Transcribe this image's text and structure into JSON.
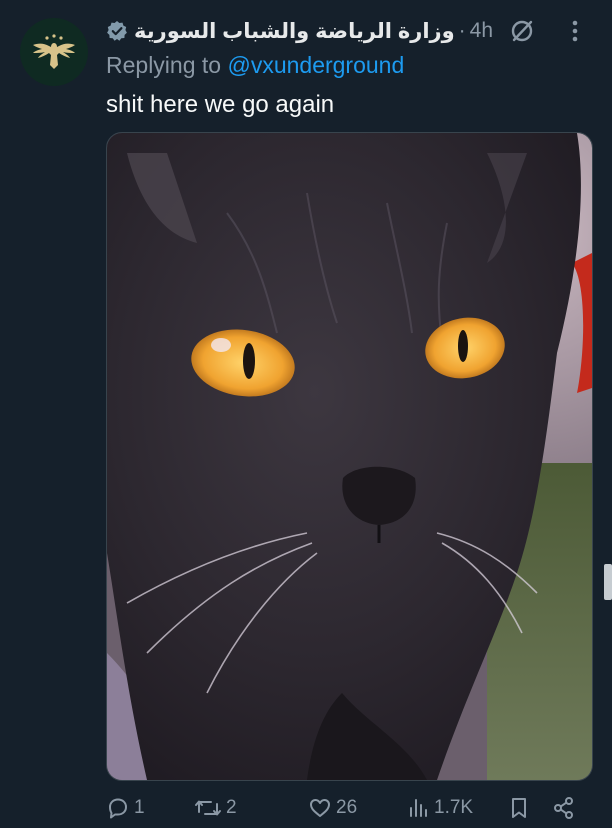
{
  "tweet": {
    "display_name": "وزارة الرياضة والشباب السورية",
    "separator": "·",
    "time": "4h",
    "reply_prefix": "Replying to ",
    "reply_handle": "@vxunderground",
    "text": "shit here we go again",
    "media_description_icon": "photo-of-black-cat"
  },
  "actions": {
    "replies": "1",
    "reposts": "2",
    "likes": "26",
    "views": "1.7K"
  },
  "colors": {
    "background": "#15202b",
    "accent": "#1d9bf0",
    "muted": "#8b98a5",
    "text": "#f7f9f9",
    "verified_badge": "#829aab"
  },
  "icons": [
    "verified-badge-icon",
    "grok-icon",
    "more-icon",
    "reply-icon",
    "repost-icon",
    "like-icon",
    "views-icon",
    "bookmark-icon",
    "share-icon"
  ]
}
